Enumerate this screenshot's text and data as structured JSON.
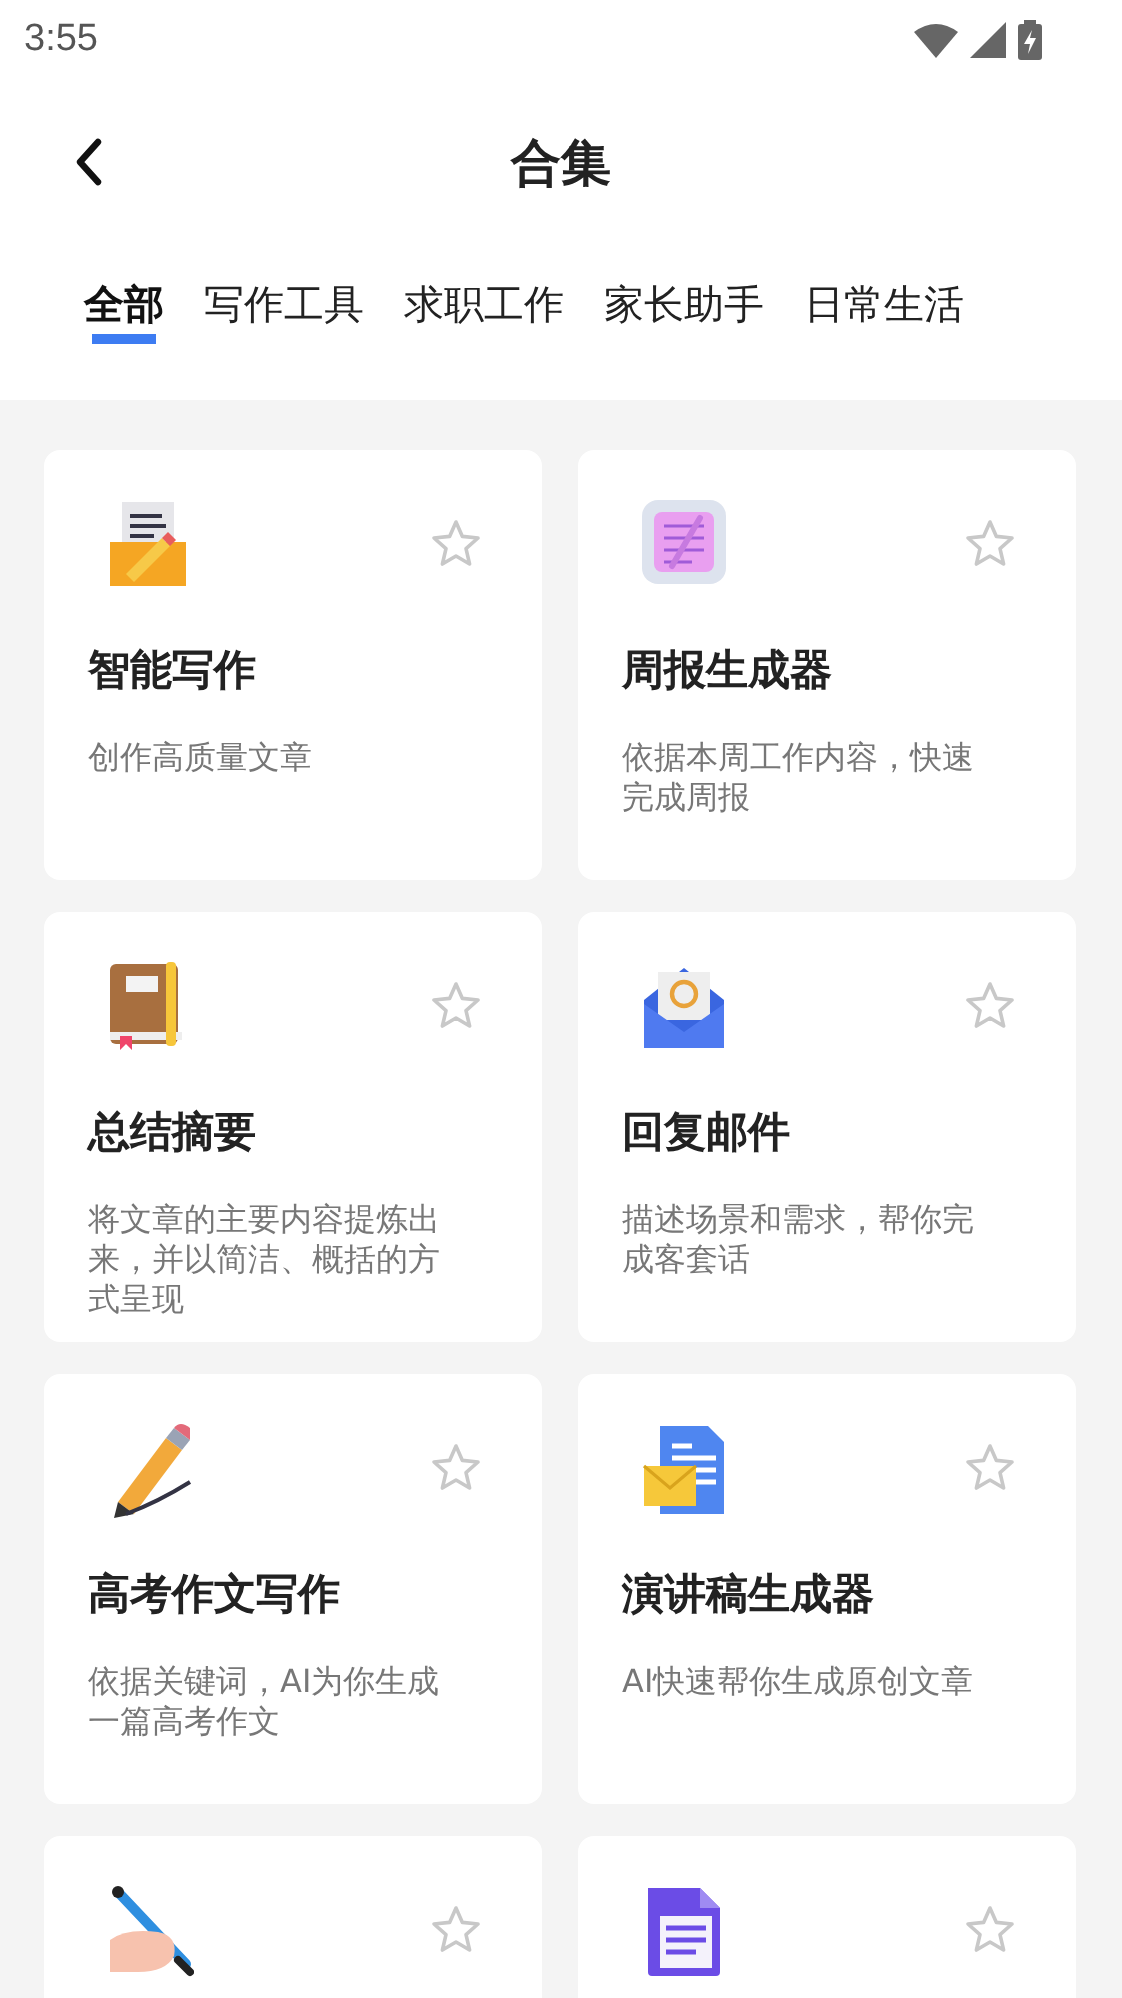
{
  "status_bar": {
    "time": "3:55"
  },
  "header": {
    "title": "合集"
  },
  "tabs": [
    {
      "label": "全部",
      "selected": true
    },
    {
      "label": "写作工具",
      "selected": false
    },
    {
      "label": "求职工作",
      "selected": false
    },
    {
      "label": "家长助手",
      "selected": false
    },
    {
      "label": "日常生活",
      "selected": false
    }
  ],
  "cards": [
    {
      "kind": "doc-pencil",
      "title": "智能写作",
      "description": "创作高质量文章",
      "starred": false
    },
    {
      "kind": "notepad",
      "title": "周报生成器",
      "description": "依据本周工作内容，快速完成周报",
      "starred": false
    },
    {
      "kind": "book",
      "title": "总结摘要",
      "description": "将文章的主要内容提炼出来，并以简洁、概括的方式呈现",
      "starred": false
    },
    {
      "kind": "mail",
      "title": "回复邮件",
      "description": "描述场景和需求，帮你完成客套话",
      "starred": false
    },
    {
      "kind": "pencil",
      "title": "高考作文写作",
      "description": "依据关键词，AI为你生成一篇高考作文",
      "starred": false
    },
    {
      "kind": "doc-mail",
      "title": "演讲稿生成器",
      "description": "AI快速帮你生成原创文章",
      "starred": false
    },
    {
      "kind": "hand-pen",
      "starred": false
    },
    {
      "kind": "document",
      "starred": false
    }
  ]
}
